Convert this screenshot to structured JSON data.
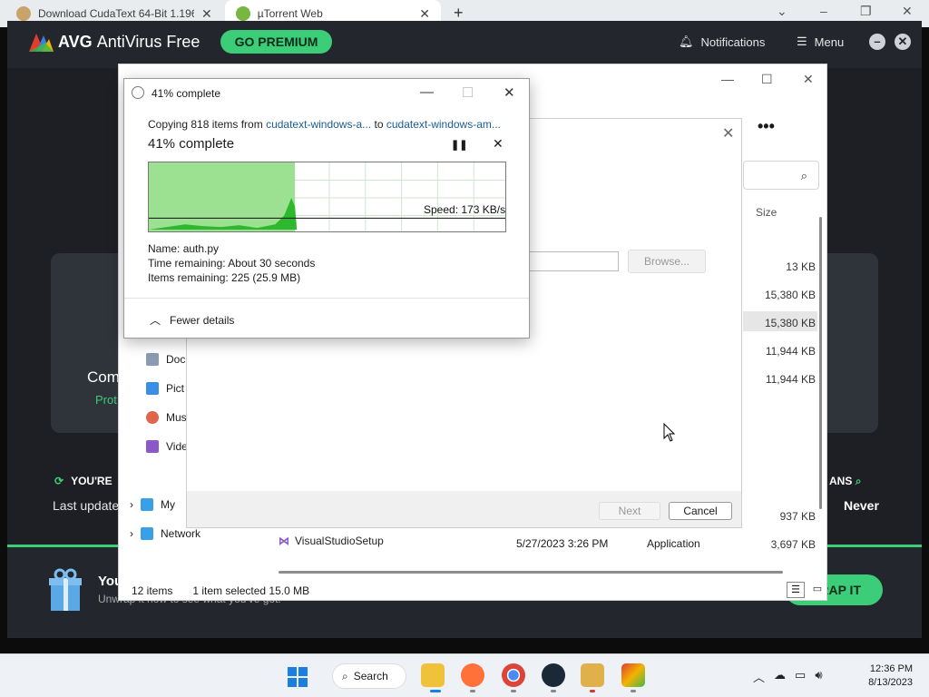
{
  "browser": {
    "tabs": [
      {
        "label": "Download CudaText 64-Bit 1.196"
      },
      {
        "label": "µTorrent Web"
      }
    ],
    "new_tab": "+",
    "window_controls": {
      "minimize": "⌄",
      "min2": "–",
      "restore": "❐",
      "close": "✕"
    }
  },
  "avg": {
    "brand": "AVG",
    "product": "AntiVirus Free",
    "go_premium": "GO PREMIUM",
    "notifications": "Notifications",
    "menu": "Menu",
    "comp_text": "Com",
    "prot_text": "Prot",
    "youre": "YOU'RE",
    "last_update": "Last update",
    "scans": "ANS",
    "never": "Never",
    "promo_title": "You",
    "promo_sub": "Unwrap it now to see what you've got.",
    "grab_it": "RAP IT",
    "accent": "#3ccd78"
  },
  "explorer": {
    "column_size": "Size",
    "sizes": [
      "13 KB",
      "15,380 KB",
      "15,380 KB",
      "11,944 KB",
      "11,944 KB",
      "937 KB",
      "3,697 KB"
    ],
    "nav": [
      "Doc",
      "Pict",
      "Mus",
      "Vide",
      "My",
      "Network"
    ],
    "row_name": "VisualStudioSetup",
    "row_date": "5/27/2023 3:26 PM",
    "row_type": "Application",
    "status_items": "12 items",
    "status_selected": "1 item selected",
    "status_size": "15.0 MB",
    "more": "•••"
  },
  "wizard": {
    "browse": "Browse...",
    "next": "Next",
    "cancel": "Cancel"
  },
  "copy_dialog": {
    "title": "41% complete",
    "copying_prefix": "Copying 818 items from",
    "from": "cudatext-windows-a...",
    "to_word": "to",
    "to": "cudatext-windows-am...",
    "percent_text": "41% complete",
    "progress": 0.41,
    "speed": "Speed: 173 KB/s",
    "name_label": "Name:",
    "name_value": "auth.py",
    "time_label": "Time remaining:",
    "time_value": "About 30 seconds",
    "items_label": "Items remaining:",
    "items_value": "225 (25.9 MB)",
    "fewer_details": "Fewer details"
  },
  "taskbar": {
    "search": "Search",
    "time": "12:36 PM",
    "date": "8/13/2023"
  }
}
